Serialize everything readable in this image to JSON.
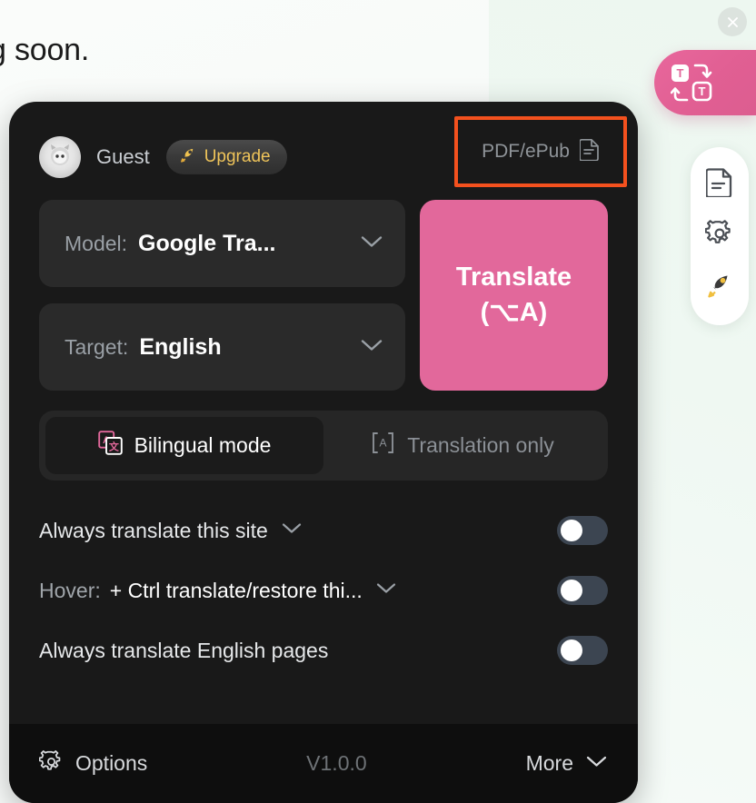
{
  "background": {
    "page_text": "g soon."
  },
  "close_button": {
    "icon": "close-icon",
    "label": ""
  },
  "floating_ball": {
    "icon": "translate-swap-icon",
    "label": ""
  },
  "side_toolbar": {
    "items": [
      {
        "icon": "document-icon",
        "label": ""
      },
      {
        "icon": "gear-icon",
        "label": ""
      },
      {
        "icon": "rocket-icon",
        "label": ""
      }
    ]
  },
  "panel": {
    "header": {
      "avatar_icon": "cat-avatar-icon",
      "user_name": "Guest",
      "upgrade": {
        "icon": "rocket-icon",
        "label": "Upgrade",
        "color": "#efc45a"
      },
      "pdf_button": {
        "label": "PDF/ePub",
        "icon": "document-icon",
        "highlight_color": "#f4511e"
      }
    },
    "model_row": {
      "label": "Model:",
      "value": "Google Tra...",
      "chevron": "chevron-down-icon"
    },
    "target_row": {
      "label": "Target:",
      "value": "English",
      "chevron": "chevron-down-icon"
    },
    "translate_button": {
      "label_line1": "Translate",
      "label_line2": "(⌥A)",
      "color": "#e2689b"
    },
    "mode_switch": {
      "bilingual": {
        "label": "Bilingual mode",
        "icon": "bilingual-icon",
        "active": true
      },
      "translation_only": {
        "label": "Translation only",
        "icon": "letter-a-icon",
        "active": false
      }
    },
    "options": [
      {
        "label": "Always translate this site",
        "value": "",
        "has_chevron": true,
        "toggle_on": false
      },
      {
        "label": "Hover:",
        "value": "+ Ctrl translate/restore thi...",
        "has_chevron": true,
        "toggle_on": false
      },
      {
        "label": "Always translate English pages",
        "value": "",
        "has_chevron": false,
        "toggle_on": false
      }
    ],
    "footer": {
      "options_label": "Options",
      "options_icon": "gear-icon",
      "version": "V1.0.0",
      "more_label": "More",
      "more_chevron": "chevron-down-icon"
    }
  }
}
